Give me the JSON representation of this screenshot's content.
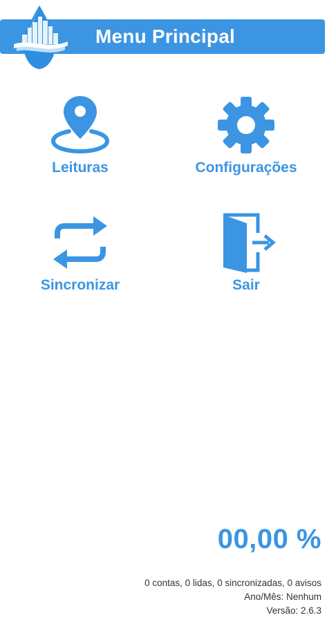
{
  "header": {
    "title": "Menu Principal"
  },
  "menu": {
    "items": [
      {
        "id": "leituras",
        "label": "Leituras",
        "icon": "map-pin-icon"
      },
      {
        "id": "config",
        "label": "Configurações",
        "icon": "gear-icon"
      },
      {
        "id": "sync",
        "label": "Sincronizar",
        "icon": "sync-arrows-icon"
      },
      {
        "id": "sair",
        "label": "Sair",
        "icon": "exit-door-icon"
      }
    ]
  },
  "status": {
    "progress": "00,00 %",
    "stats": "0 contas, 0 lidas, 0 sincronizadas, 0 avisos",
    "period": "Ano/Mês: Nenhum",
    "version": "Versão: 2.6.3"
  },
  "colors": {
    "accent": "#3b95e2",
    "text": "#333333",
    "background": "#ffffff"
  }
}
